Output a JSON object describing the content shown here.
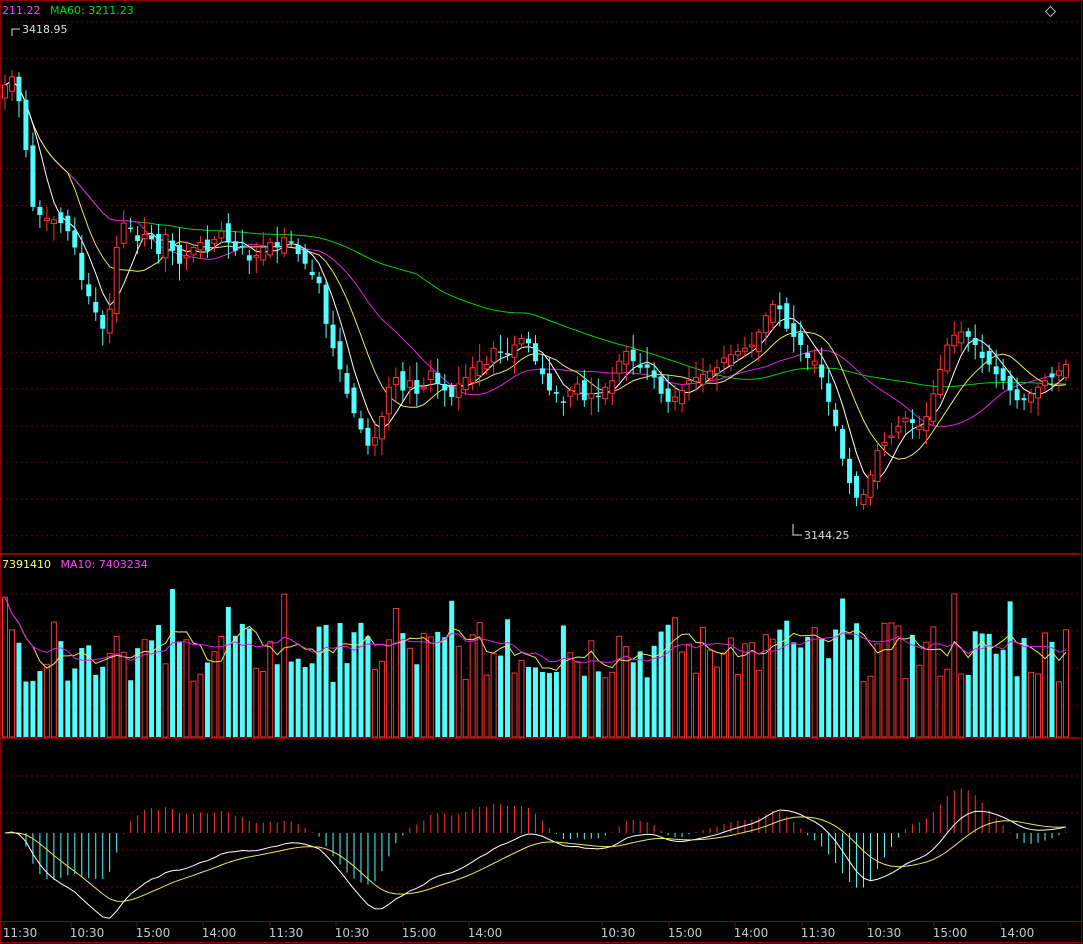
{
  "legend": {
    "price": [
      {
        "text": "211.22",
        "color": "#ff40ff"
      },
      {
        "text": "MA60: 3211.23",
        "color": "#00e000"
      }
    ],
    "volume": [
      {
        "text": "7391410",
        "color": "#ffff66"
      },
      {
        "text": "MA10: 7403234",
        "color": "#ff40ff"
      }
    ]
  },
  "chart_data": {
    "type": "candlestick",
    "price": {
      "ylim": [
        3120,
        3440
      ],
      "high_label": "3418.95",
      "low_label": "3144.25",
      "closes": [
        3400,
        3405,
        3390,
        3360,
        3325,
        3320,
        3318,
        3317,
        3315,
        3310,
        3300,
        3280,
        3270,
        3260,
        3250,
        3262,
        3300,
        3315,
        3312,
        3304,
        3308,
        3305,
        3296,
        3308,
        3298,
        3290,
        3295,
        3300,
        3303,
        3298,
        3305,
        3310,
        3303,
        3298,
        3300,
        3292,
        3295,
        3300,
        3303,
        3300,
        3306,
        3303,
        3296,
        3290,
        3283,
        3278,
        3253,
        3238,
        3225,
        3210,
        3198,
        3188,
        3178,
        3183,
        3196,
        3214,
        3220,
        3212,
        3218,
        3210,
        3214,
        3224,
        3216,
        3212,
        3208,
        3216,
        3220,
        3226,
        3230,
        3228,
        3238,
        3236,
        3234,
        3240,
        3244,
        3241,
        3230,
        3222,
        3212,
        3210,
        3205,
        3212,
        3216,
        3206,
        3210,
        3208,
        3214,
        3218,
        3230,
        3236,
        3230,
        3226,
        3226,
        3220,
        3210,
        3205,
        3208,
        3212,
        3218,
        3220,
        3222,
        3224,
        3226,
        3232,
        3234,
        3236,
        3238,
        3240,
        3248,
        3258,
        3265,
        3262,
        3250,
        3245,
        3240,
        3232,
        3230,
        3220,
        3205,
        3190,
        3170,
        3155,
        3146,
        3148,
        3160,
        3175,
        3180,
        3184,
        3190,
        3195,
        3192,
        3190,
        3196,
        3210,
        3225,
        3240,
        3246,
        3248,
        3245,
        3240,
        3232,
        3228,
        3222,
        3218,
        3212,
        3206,
        3206,
        3210,
        3214,
        3218,
        3220,
        3224,
        3228
      ]
    },
    "volume": {
      "ma10": "7403234",
      "last": "7391410"
    },
    "x_ticks": [
      "11:30",
      "10:30",
      "15:00",
      "14:00",
      "11:30",
      "10:30",
      "15:00",
      "14:00",
      "10:30",
      "15:00",
      "14:00",
      "11:30",
      "10:30",
      "15:00",
      "14:00"
    ]
  }
}
